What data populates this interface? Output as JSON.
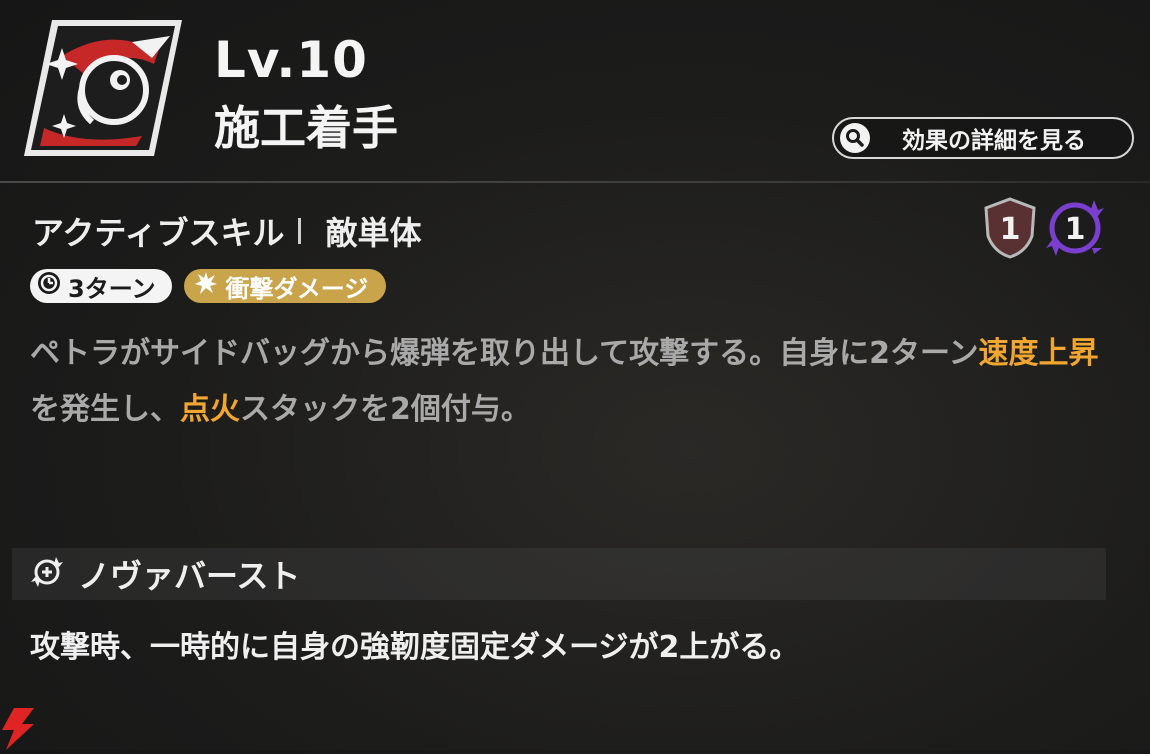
{
  "header": {
    "level": "Lv.10",
    "skill_name": "施工着手",
    "detail_button_label": "効果の詳細を見る"
  },
  "skill": {
    "type": "アクティブスキル",
    "target": "敵単体",
    "badges": [
      {
        "icon": "shield-badge-icon",
        "value": "1",
        "color": "#6d3a3c"
      },
      {
        "icon": "nova-badge-icon",
        "value": "1",
        "color": "#7b3fd0"
      }
    ],
    "tags": {
      "turns": "3ターン",
      "damage_type": "衝撃ダメージ"
    },
    "description": {
      "p1": "ペトラがサイドバッグから爆弾を取り出して攻撃する。自身に2ターン",
      "h1": "速度上昇",
      "p2": "を発生し、",
      "h2": "点火",
      "p3": "スタックを2個付与。"
    }
  },
  "nova": {
    "title": "ノヴァバースト",
    "description": "攻撃時、一時的に自身の強靭度固定ダメージが2上がる。"
  },
  "colors": {
    "highlight": "#f0a630",
    "damage_tag": "#c9a44a",
    "background": "#1c1c1b"
  }
}
